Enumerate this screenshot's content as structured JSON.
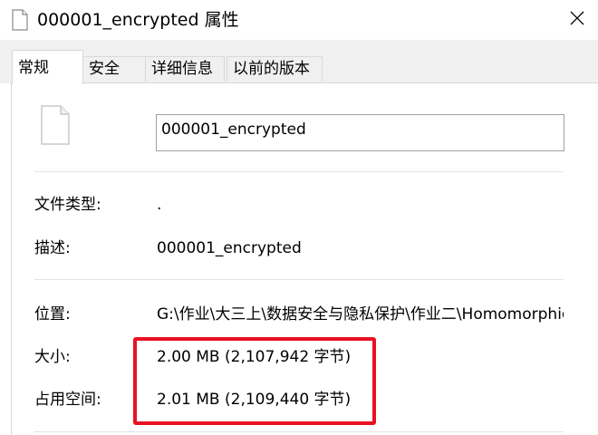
{
  "window": {
    "title": "000001_encrypted 属性",
    "title_icon": "file-icon",
    "close_icon": "close-icon"
  },
  "tabs": [
    {
      "label": "常规",
      "active": true
    },
    {
      "label": "安全",
      "active": false
    },
    {
      "label": "详细信息",
      "active": false
    },
    {
      "label": "以前的版本",
      "active": false
    }
  ],
  "general": {
    "file_icon": "blank-file-icon",
    "filename": "000001_encrypted",
    "type_label": "文件类型:",
    "type_value": ".",
    "desc_label": "描述:",
    "desc_value": "000001_encrypted",
    "location_label": "位置:",
    "location_value": "G:\\作业\\大三上\\数据安全与隐私保护\\作业二\\Homomorphic",
    "size_label": "大小:",
    "size_value": "2.00 MB (2,107,942 字节)",
    "disk_label": "占用空间:",
    "disk_value": "2.01 MB (2,109,440 字节)"
  },
  "colors": {
    "highlight": "#e81123",
    "tab_background": "#f0f0f0",
    "border": "#d9d9d9"
  }
}
